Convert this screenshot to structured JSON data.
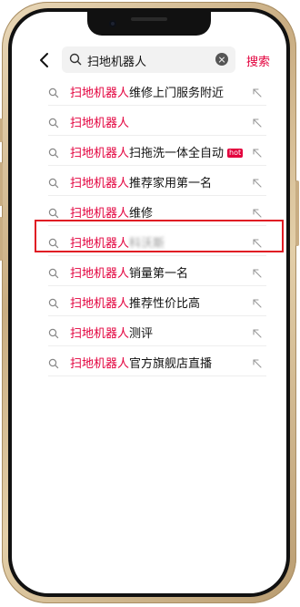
{
  "search": {
    "query": "扫地机器人",
    "button_label": "搜索"
  },
  "suggestions": [
    {
      "prefix": "扫地机器人",
      "suffix": "维修上门服务附近",
      "badge": ""
    },
    {
      "prefix": "扫地机器人",
      "suffix": "",
      "badge": ""
    },
    {
      "prefix": "扫地机器人",
      "suffix": "扫拖洗一体全自动",
      "badge": "hot"
    },
    {
      "prefix": "扫地机器人",
      "suffix": "推荐家用第一名",
      "badge": ""
    },
    {
      "prefix": "扫地机器人",
      "suffix": "维修",
      "badge": ""
    },
    {
      "prefix": "扫地机器人",
      "suffix": "科沃斯",
      "badge": ""
    },
    {
      "prefix": "扫地机器人",
      "suffix": "销量第一名",
      "badge": ""
    },
    {
      "prefix": "扫地机器人",
      "suffix": "推荐性价比高",
      "badge": ""
    },
    {
      "prefix": "扫地机器人",
      "suffix": "测评",
      "badge": ""
    },
    {
      "prefix": "扫地机器人",
      "suffix": "官方旗舰店直播",
      "badge": ""
    }
  ],
  "colors": {
    "accent": "#e3003d",
    "highlight_border": "#e01b24"
  },
  "icons": {
    "back": "chevron-left-icon",
    "search": "search-icon",
    "clear": "clear-icon",
    "fill_arrow": "arrow-up-left-icon"
  }
}
